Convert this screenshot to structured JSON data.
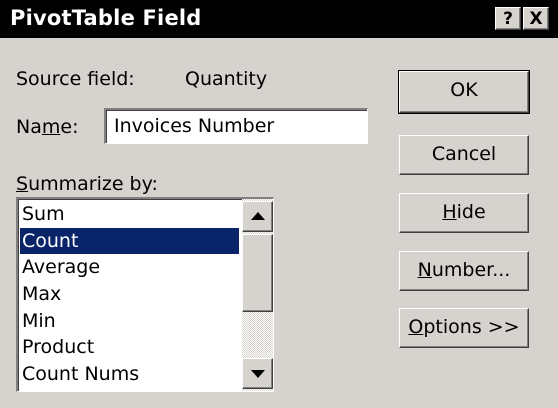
{
  "window": {
    "title": "PivotTable Field",
    "help_label": "?",
    "close_label": "X"
  },
  "source": {
    "label": "Source field:",
    "value": "Quantity"
  },
  "name": {
    "label_pre": "Na",
    "label_key": "m",
    "label_post": "e:",
    "value": "Invoices Number"
  },
  "summarize": {
    "label_key": "S",
    "label_post": "ummarize by:",
    "items": [
      "Sum",
      "Count",
      "Average",
      "Max",
      "Min",
      "Product",
      "Count Nums"
    ],
    "selected": "Count"
  },
  "buttons": {
    "ok": "OK",
    "cancel": "Cancel",
    "hide_key": "H",
    "hide_post": "ide",
    "number_key": "N",
    "number_post": "umber...",
    "options_key": "O",
    "options_post": "ptions >>"
  }
}
